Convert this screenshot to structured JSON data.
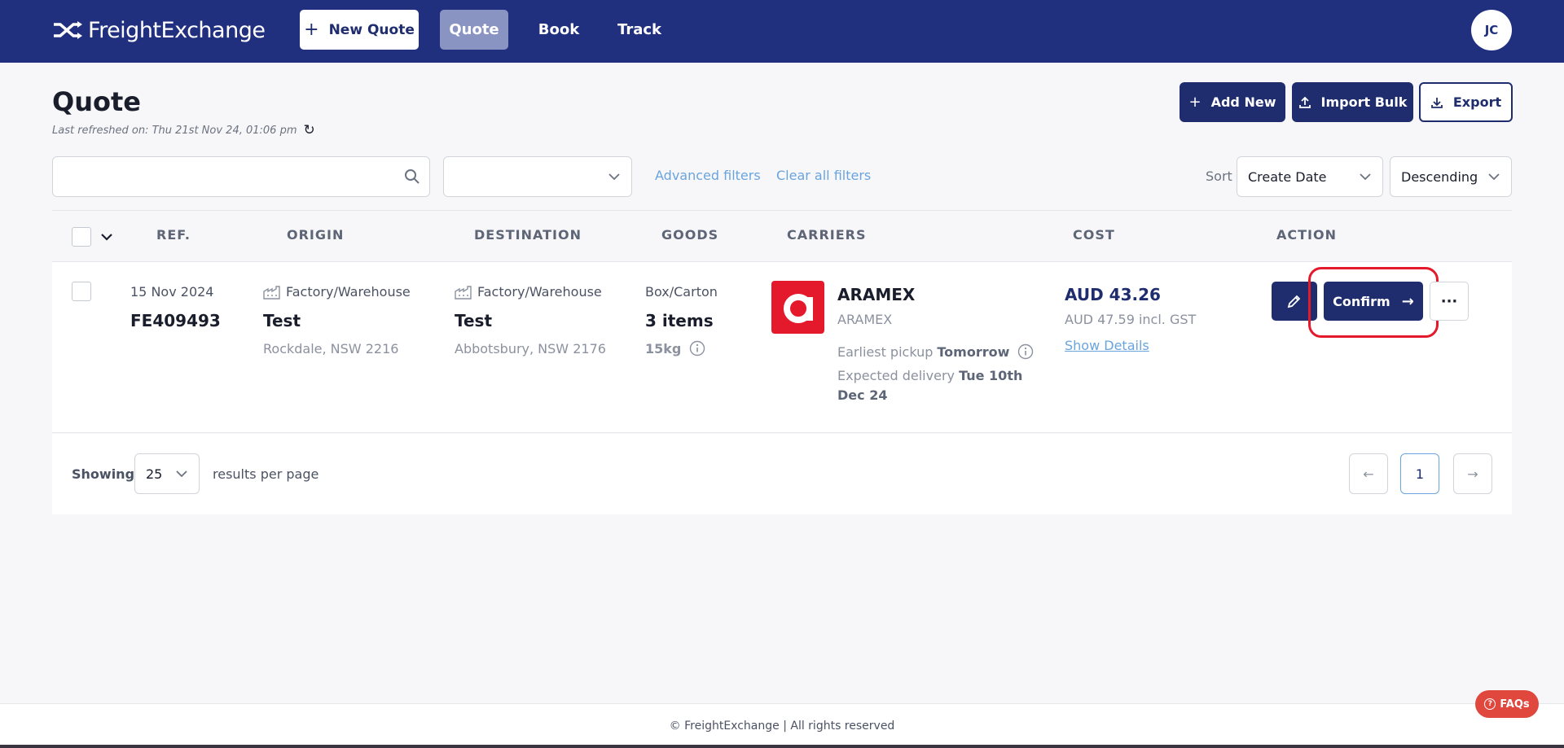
{
  "app": {
    "brand": "FreightExchange"
  },
  "nav": {
    "new_quote": "New Quote",
    "items": [
      {
        "label": "Quote",
        "active": true
      },
      {
        "label": "Book",
        "active": false
      },
      {
        "label": "Track",
        "active": false
      }
    ],
    "user_initials": "JC"
  },
  "header": {
    "title": "Quote",
    "last_refreshed": "Last refreshed on: Thu 21st Nov 24, 01:06 pm",
    "buttons": {
      "add_new": "Add New",
      "import_bulk": "Import Bulk",
      "export": "Export"
    }
  },
  "filters": {
    "search_value": "",
    "dropdown_value": "",
    "advanced": "Advanced filters",
    "clear": "Clear all filters",
    "sort_label": "Sort",
    "sort_field": "Create Date",
    "sort_direction": "Descending"
  },
  "table": {
    "columns": [
      "REF.",
      "ORIGIN",
      "DESTINATION",
      "GOODS",
      "CARRIERS",
      "COST",
      "ACTION"
    ],
    "rows": [
      {
        "date": "15 Nov 2024",
        "ref": "FE409493",
        "origin": {
          "type": "Factory/Warehouse",
          "name": "Test",
          "location": "Rockdale, NSW 2216"
        },
        "destination": {
          "type": "Factory/Warehouse",
          "name": "Test",
          "location": "Abbotsbury, NSW 2176"
        },
        "goods": {
          "type": "Box/Carton",
          "items": "3 items",
          "weight": "15kg"
        },
        "carrier": {
          "name": "ARAMEX",
          "sub": "ARAMEX",
          "pickup_label": "Earliest pickup",
          "pickup_value": "Tomorrow",
          "delivery_label": "Expected delivery",
          "delivery_value": "Tue 10th Dec 24"
        },
        "cost": {
          "amount": "AUD 43.26",
          "incl_gst": "AUD 47.59 incl. GST",
          "details_link": "Show Details"
        },
        "actions": {
          "confirm": "Confirm",
          "more": "···"
        }
      }
    ]
  },
  "pagination": {
    "showing": "Showing",
    "per_page": "25",
    "per_page_label": "results per page",
    "current_page": "1"
  },
  "footer": {
    "copyright": "© FreightExchange | All rights reserved",
    "faqs": "FAQs"
  },
  "colors": {
    "primary": "#1f2d6e",
    "topbar": "#20307f",
    "link": "#6aa4dd",
    "carrier_brand": "#e4192c",
    "highlight": "#e4192c"
  },
  "icons": [
    "shuffle-logo-icon",
    "plus-icon",
    "refresh-icon",
    "upload-icon",
    "download-icon",
    "search-icon",
    "chevron-down-icon",
    "factory-icon",
    "info-icon",
    "pencil-icon",
    "arrow-right-icon",
    "arrow-left-icon",
    "question-icon"
  ]
}
